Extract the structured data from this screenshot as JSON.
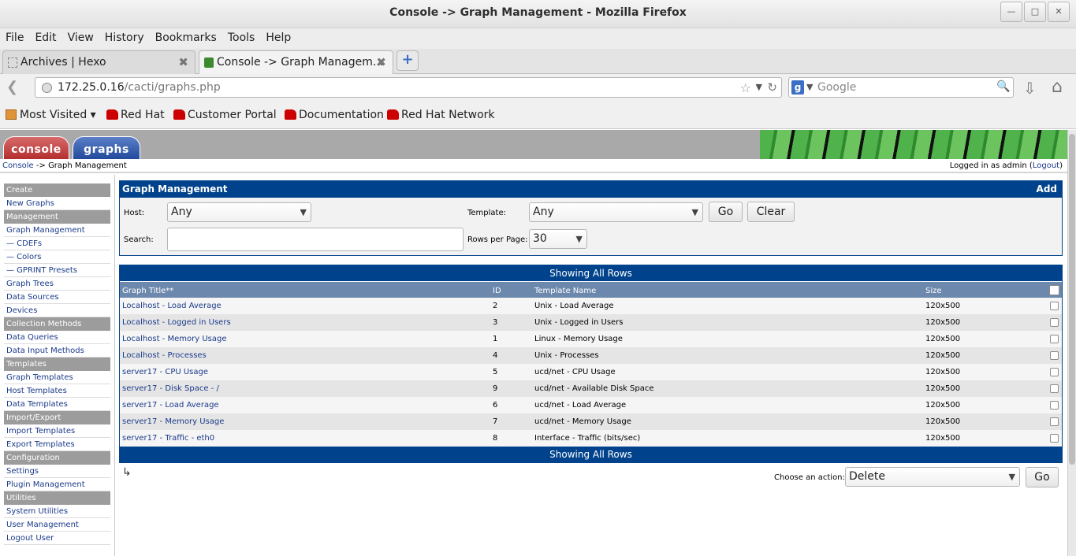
{
  "window": {
    "title": "Console -> Graph Management - Mozilla Firefox"
  },
  "menu": [
    "File",
    "Edit",
    "View",
    "History",
    "Bookmarks",
    "Tools",
    "Help"
  ],
  "tabs": [
    {
      "label": "Archives | Hexo"
    },
    {
      "label": "Console -> Graph Managem..."
    }
  ],
  "address": {
    "host": "172.25.0.16",
    "path": "/cacti/graphs.php"
  },
  "search": {
    "placeholder": "Google"
  },
  "bookmarks": [
    "Most Visited",
    "Red Hat",
    "Customer Portal",
    "Documentation",
    "Red Hat Network"
  ],
  "cacti_tabs": {
    "console": "console",
    "graphs": "graphs"
  },
  "breadcrumb": {
    "root": "Console",
    "sep": " -> ",
    "current": "Graph Management"
  },
  "login": {
    "prefix": "Logged in as admin (",
    "logout": "Logout",
    "suffix": ")"
  },
  "sidebar": [
    {
      "label": "Create",
      "type": "header"
    },
    {
      "label": "New Graphs",
      "type": "link"
    },
    {
      "label": "Management",
      "type": "header"
    },
    {
      "label": "Graph Management",
      "type": "link"
    },
    {
      "label": "— CDEFs",
      "type": "link"
    },
    {
      "label": "— Colors",
      "type": "link"
    },
    {
      "label": "— GPRINT Presets",
      "type": "link"
    },
    {
      "label": "Graph Trees",
      "type": "link"
    },
    {
      "label": "Data Sources",
      "type": "link"
    },
    {
      "label": "Devices",
      "type": "link"
    },
    {
      "label": "Collection Methods",
      "type": "header"
    },
    {
      "label": "Data Queries",
      "type": "link"
    },
    {
      "label": "Data Input Methods",
      "type": "link"
    },
    {
      "label": "Templates",
      "type": "header"
    },
    {
      "label": "Graph Templates",
      "type": "link"
    },
    {
      "label": "Host Templates",
      "type": "link"
    },
    {
      "label": "Data Templates",
      "type": "link"
    },
    {
      "label": "Import/Export",
      "type": "header"
    },
    {
      "label": "Import Templates",
      "type": "link"
    },
    {
      "label": "Export Templates",
      "type": "link"
    },
    {
      "label": "Configuration",
      "type": "header"
    },
    {
      "label": "Settings",
      "type": "link"
    },
    {
      "label": "Plugin Management",
      "type": "link"
    },
    {
      "label": "Utilities",
      "type": "header"
    },
    {
      "label": "System Utilities",
      "type": "link"
    },
    {
      "label": "User Management",
      "type": "link"
    },
    {
      "label": "Logout User",
      "type": "link"
    }
  ],
  "filter": {
    "heading": "Graph Management",
    "add_label": "Add",
    "host_label": "Host:",
    "host_value": "Any",
    "template_label": "Template:",
    "template_value": "Any",
    "go_label": "Go",
    "clear_label": "Clear",
    "search_label": "Search:",
    "search_value": "",
    "rows_label": "Rows per Page:",
    "rows_value": "30"
  },
  "grid": {
    "showing_label": "Showing All Rows",
    "columns": [
      "Graph Title**",
      "ID",
      "Template Name",
      "Size"
    ],
    "rows": [
      {
        "title": "Localhost - Load Average",
        "id": "2",
        "template": "Unix - Load Average",
        "size": "120x500"
      },
      {
        "title": "Localhost - Logged in Users",
        "id": "3",
        "template": "Unix - Logged in Users",
        "size": "120x500"
      },
      {
        "title": "Localhost - Memory Usage",
        "id": "1",
        "template": "Linux - Memory Usage",
        "size": "120x500"
      },
      {
        "title": "Localhost - Processes",
        "id": "4",
        "template": "Unix - Processes",
        "size": "120x500"
      },
      {
        "title": "server17 - CPU Usage",
        "id": "5",
        "template": "ucd/net - CPU Usage",
        "size": "120x500"
      },
      {
        "title": "server17 - Disk Space - /",
        "id": "9",
        "template": "ucd/net - Available Disk Space",
        "size": "120x500"
      },
      {
        "title": "server17 - Load Average",
        "id": "6",
        "template": "ucd/net - Load Average",
        "size": "120x500"
      },
      {
        "title": "server17 - Memory Usage",
        "id": "7",
        "template": "ucd/net - Memory Usage",
        "size": "120x500"
      },
      {
        "title": "server17 - Traffic - eth0",
        "id": "8",
        "template": "Interface - Traffic (bits/sec)",
        "size": "120x500"
      }
    ]
  },
  "action": {
    "label": "Choose an action:",
    "value": "Delete",
    "go_label": "Go"
  }
}
